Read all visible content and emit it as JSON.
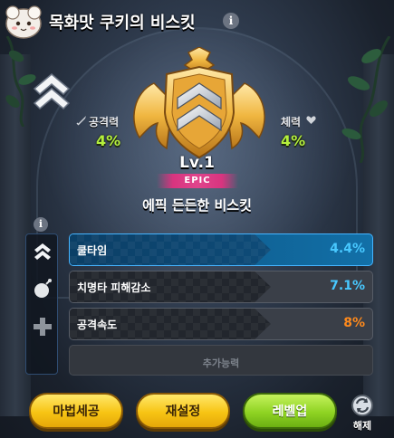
{
  "header": {
    "title": "목화맛 쿠키의 비스킷",
    "info_icon": "i"
  },
  "stats": {
    "attack_label": "공격력",
    "attack_value": "4%",
    "hp_label": "체력",
    "hp_value": "4%"
  },
  "biscuit": {
    "level": "Lv.1",
    "rarity": "EPIC",
    "name": "에픽 든든한 비스킷"
  },
  "rail": {
    "info_icon": "i"
  },
  "options": [
    {
      "name": "쿨타임",
      "value": "4.4%",
      "value_color": "#48c8ff",
      "active": true
    },
    {
      "name": "치명타 피해감소",
      "value": "7.1%",
      "value_color": "#48c8ff",
      "active": false
    },
    {
      "name": "공격속도",
      "value": "8%",
      "value_color": "#ff8a1c",
      "active": false
    },
    {
      "name": "추가능력",
      "value": "",
      "active": false,
      "empty": true
    }
  ],
  "buttons": {
    "magic_forge": "마법세공",
    "reset": "재설정",
    "level_up": "레벨업",
    "release": "해제"
  },
  "colors": {
    "stat_green": "#b5f03c",
    "rarity_pink": "#e0448c",
    "active_blue": "#45b4ff",
    "button_yellow": "#f7c414",
    "button_green": "#8fd323"
  }
}
